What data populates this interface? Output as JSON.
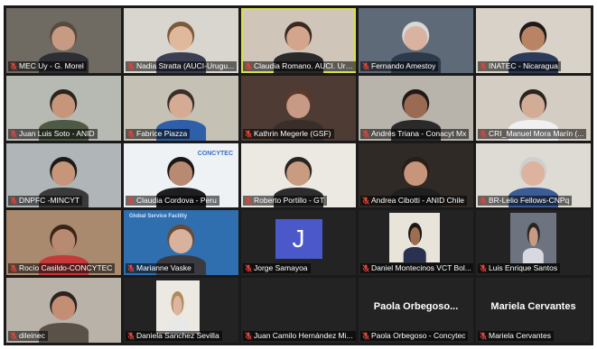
{
  "participants": [
    {
      "name": "MEC Uy - G. Morel",
      "bg": "#6f6b63",
      "skin": "#c79a84",
      "shirt": "#2e2e33",
      "hair": "#5a4a3e"
    },
    {
      "name": "Nadia Stratta (AUCI-Urugu...",
      "bg": "#d9d6cf",
      "skin": "#e0b89c",
      "shirt": "#3c3f52",
      "hair": "#7a5a3a"
    },
    {
      "name": "Claudia Romano. AUCI. Urugu...",
      "bg": "#cfc5b8",
      "skin": "#d3a58c",
      "shirt": "#2a2a2a",
      "hair": "#3a2a22"
    },
    {
      "name": "Fernando Amestoy",
      "bg": "#5f6a78",
      "skin": "#d9b3a0",
      "shirt": "#2c3a4a",
      "hair": "#d8d8d8"
    },
    {
      "name": "INATEC - Nicaragua",
      "bg": "#d8d2c8",
      "skin": "#b88465",
      "shirt": "#2d3a5a",
      "hair": "#1f1a18"
    },
    {
      "name": "Juan Luis Soto - ANID",
      "bg": "#b7b9b3",
      "skin": "#c7957a",
      "shirt": "#4f5a44",
      "hair": "#2a2420"
    },
    {
      "name": "Fabrice Piazza",
      "bg": "#c6c1b5",
      "skin": "#d6ab93",
      "shirt": "#2f5fa8",
      "hair": "#3a2e28"
    },
    {
      "name": "Kathrin Megerle (GSF)",
      "bg": "#4d3b34",
      "skin": "#c69a84",
      "shirt": "#3a2e2a",
      "hair": "#5a3a2c"
    },
    {
      "name": "Andrés Triana - Conacyt Mx",
      "bg": "#b9b4ab",
      "skin": "#9a6a52",
      "shirt": "#2a2a2a",
      "hair": "#1f1a18"
    },
    {
      "name": "CRI_Manuel Mora Marín (...",
      "bg": "#d4cdc3",
      "skin": "#d3ac98",
      "shirt": "#f0f0f0",
      "hair": "#2a2420"
    },
    {
      "name": "DNPFC -MINCYT",
      "bg": "#b0b5b8",
      "skin": "#c7957a",
      "shirt": "#3a3a3a",
      "hair": "#1f1a18"
    },
    {
      "name": "Claudia Cordova - Peru",
      "bg": "#eef2f5",
      "skin": "#b98a72",
      "shirt": "#1e1e22",
      "hair": "#1a1614"
    },
    {
      "name": "Roberto Portillo - GT",
      "bg": "#ece8e2",
      "skin": "#c99c82",
      "shirt": "#2d2d30",
      "hair": "#2a2420"
    },
    {
      "name": "Andrea Cibotti - ANID Chile",
      "bg": "#2f2a26",
      "skin": "#c7957a",
      "shirt": "#1f1f1f",
      "hair": "#2a1c16"
    },
    {
      "name": "BR-Lelio Fellows-CNPq",
      "bg": "#dedbd5",
      "skin": "#dcb39e",
      "shirt": "#3b5c96",
      "hair": "#cfcfcf"
    },
    {
      "name": "Rocío Casildo-CONCYTEC",
      "bg": "#a98a6e",
      "skin": "#b98a72",
      "shirt": "#c43a3a",
      "hair": "#3a2418"
    },
    {
      "name": "Marianne Vaske",
      "bg": "#2f6fb0",
      "skin": "#d8b29c",
      "shirt": "#3a3a40",
      "hair": "#6a4a34"
    },
    {
      "name": "Jorge Samayoa",
      "bg": "#232323",
      "avatar_letter": "J"
    },
    {
      "name": "Daniel Montecinos VCT Bol...",
      "bg": "#232323",
      "skin": "#9f6c52",
      "shirt": "#2a3050",
      "hair": "#1c1816"
    },
    {
      "name": "Luis Enrique Santos",
      "bg": "#232323",
      "skin": "#c69a84",
      "shirt": "#d8d8e0",
      "hair": "#2a2420"
    },
    {
      "name": "dileinec",
      "bg": "#b9b2a8",
      "skin": "#c48e74",
      "shirt": "#5a5148",
      "hair": "#2a2420"
    },
    {
      "name": "Daniela Sanchez Sevilla",
      "bg": "#232323",
      "skin": "#dcb6a0",
      "shirt": "#e8e8e8",
      "hair": "#b08a5a"
    },
    {
      "name": "Juan Camilo Hernández Mi...",
      "bg": "#232323"
    },
    {
      "name": "Paola Orbegoso - Concytec",
      "bg": "#232323",
      "display_name": "Paola Orbegoso..."
    },
    {
      "name": "Mariela Cervantes",
      "bg": "#232323",
      "display_name": "Mariela Cervantes"
    }
  ],
  "tile_extras": {
    "concytec_logo": "CONCYTEC",
    "global_service_banner": "Global Service Facility"
  },
  "colors": {
    "active_speaker_border": "#d8e04a",
    "mic_muted": "#e0443a",
    "avatar_bg": "#4a58c9"
  }
}
